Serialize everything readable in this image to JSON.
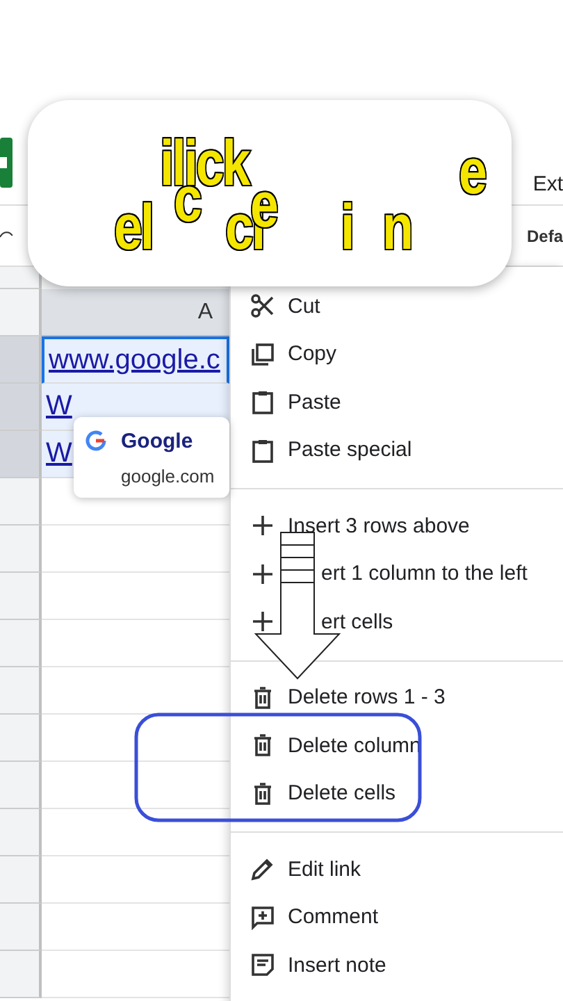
{
  "caption": {
    "pieces": [
      "ilick",
      "e",
      "el",
      "c",
      "cl",
      "e",
      "i",
      "n"
    ]
  },
  "header": {
    "menu_partial": "Ext",
    "font_partial": "Defa"
  },
  "sheet": {
    "column_header": "A",
    "rows": [
      {
        "cell": "www.google.c",
        "selected": true
      },
      {
        "cell": "W",
        "selected": true
      },
      {
        "cell": "W",
        "selected": true
      }
    ]
  },
  "link_preview": {
    "title": "Google",
    "url": "google.com"
  },
  "context_menu": {
    "sections": [
      [
        {
          "kind": "cut",
          "label": "Cut"
        },
        {
          "kind": "copy",
          "label": "Copy"
        },
        {
          "kind": "paste",
          "label": "Paste"
        },
        {
          "kind": "paste",
          "label": "Paste special"
        }
      ],
      [
        {
          "kind": "plus",
          "label": "Insert 3 rows above"
        },
        {
          "kind": "plus",
          "label": "ert 1 column to the left"
        },
        {
          "kind": "plus",
          "label": "ert cells"
        }
      ],
      [
        {
          "kind": "trash",
          "label": "Delete rows 1 - 3"
        },
        {
          "kind": "trash",
          "label": "Delete column"
        },
        {
          "kind": "trash",
          "label": "Delete cells"
        }
      ],
      [
        {
          "kind": "pencil",
          "label": "Edit link"
        },
        {
          "kind": "comment",
          "label": "Comment"
        },
        {
          "kind": "note",
          "label": "Insert note"
        }
      ]
    ]
  }
}
